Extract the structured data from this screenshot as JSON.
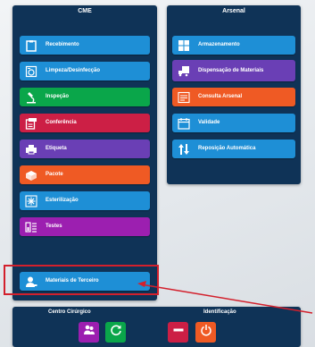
{
  "cme": {
    "title": "CME",
    "items": [
      {
        "label": "Recebimento",
        "icon": "clipboard-icon",
        "color": "#1e8fd6"
      },
      {
        "label": "Limpeza/Desinfecção",
        "icon": "washer-icon",
        "color": "#1e8fd6"
      },
      {
        "label": "Inspeção",
        "icon": "microscope-icon",
        "color": "#0aa64a"
      },
      {
        "label": "Conferência",
        "icon": "checklist-icon",
        "color": "#cc1f45"
      },
      {
        "label": "Etiqueta",
        "icon": "printer-icon",
        "color": "#6a3fb5"
      },
      {
        "label": "Pacote",
        "icon": "package-icon",
        "color": "#ef5a24"
      },
      {
        "label": "Esterilização",
        "icon": "snowflake-icon",
        "color": "#1e8fd6"
      },
      {
        "label": "Testes",
        "icon": "test-tubes-icon",
        "color": "#9c1fb0"
      },
      {
        "label": "Materiais de Terceiro",
        "icon": "user-icon",
        "color": "#1e8fd6"
      }
    ]
  },
  "arsenal": {
    "title": "Arsenal",
    "items": [
      {
        "label": "Armazenamento",
        "icon": "grid-storage-icon",
        "color": "#1e8fd6"
      },
      {
        "label": "Dispensação de Materiais",
        "icon": "truck-box-icon",
        "color": "#6a3fb5"
      },
      {
        "label": "Consulta Arsenal",
        "icon": "list-search-icon",
        "color": "#ef5a24"
      },
      {
        "label": "Validade",
        "icon": "calendar-icon",
        "color": "#1e8fd6"
      },
      {
        "label": "Reposição Automática",
        "icon": "sort-arrows-icon",
        "color": "#1e8fd6"
      }
    ]
  },
  "footer": {
    "centro_label": "Centro Cirúrgico",
    "identificacao_label": "Identificação",
    "buttons": [
      {
        "icon": "users-icon",
        "color": "#9c1fb0"
      },
      {
        "icon": "refresh-icon",
        "color": "#0aa64a"
      },
      {
        "icon": "minus-icon",
        "color": "#cc1f45"
      },
      {
        "icon": "power-icon",
        "color": "#ef5a24"
      }
    ]
  }
}
